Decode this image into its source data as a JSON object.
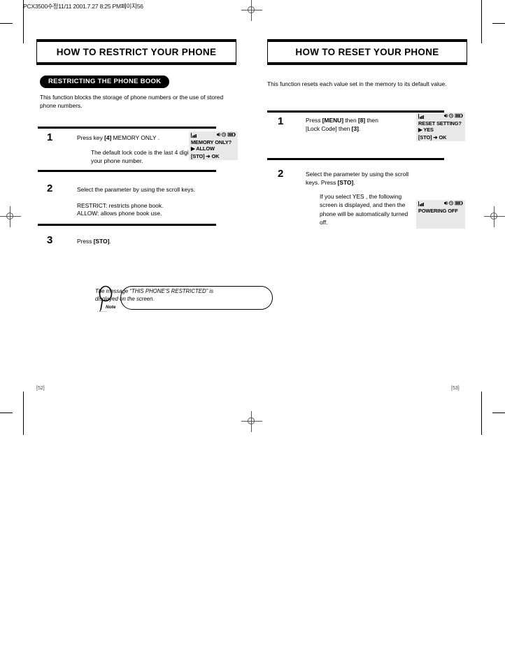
{
  "prepress": {
    "header": "PCX3500수정11/11  2001.7.27 8:25 PM페이지56"
  },
  "left_page": {
    "title": "HOW TO RESTRICT YOUR PHONE",
    "section_label": "RESTRICTING THE PHONE BOOK",
    "intro": "This function blocks the storage of phone numbers or the use of stored phone numbers.",
    "folio": "[52]",
    "steps": [
      {
        "number": "1",
        "text_plain": "Press key [4]  MEMORY ONLY .",
        "text_pre": "Press key ",
        "text_key": "[4]",
        "text_post": "  MEMORY ONLY .",
        "sub": "The default lock code is the last 4 digits of your phone number.",
        "lcd": {
          "signal": "signal-bars-icon",
          "icons": "speaker-alarm-battery-icons",
          "line1": "MEMORY ONLY?",
          "line2": "▶ ALLOW",
          "line3": "[STO] ➔ OK"
        }
      },
      {
        "number": "2",
        "text_plain": "Select the parameter by using the scroll keys.",
        "sub_a": "RESTRICT:  restricts phone book.",
        "sub_b": "ALLOW:  allows phone book use."
      },
      {
        "number": "3",
        "text_pre": "Press ",
        "text_key": "[STO]",
        "text_post": "."
      }
    ],
    "note": {
      "icon_label": "Note",
      "text": "The message “THIS PHONE’S RESTRICTED” is displayed on the screen."
    }
  },
  "right_page": {
    "title": "HOW TO RESET YOUR PHONE",
    "intro": "This function resets each value set in the memory to its default value.",
    "folio": "[53]",
    "steps": [
      {
        "number": "1",
        "line1_pre": "Press ",
        "line1_k1": "[MENU]",
        "line1_mid": " then ",
        "line1_k2": "[8]",
        "line1_post": " then",
        "line2_pre": "[Lock Code] then ",
        "line2_k1": "[3]",
        "line2_post": ".",
        "lcd": {
          "signal": "signal-bars-icon",
          "icons": "speaker-alarm-battery-icons",
          "line1": "RESET SETTING?",
          "line2": "▶ YES",
          "line3": "[STO] ➔ OK"
        }
      },
      {
        "number": "2",
        "line1": "Select the parameter by using the scroll",
        "line2_pre": "keys.  Press ",
        "line2_k1": "[STO]",
        "line2_post": ".",
        "sub": "If you select  YES , the following screen is displayed, and then the phone will be automatically turned off.",
        "lcd": {
          "signal": "signal-bars-icon",
          "icons": "speaker-alarm-battery-icons",
          "line1": "POWERING OFF",
          "line2": "",
          "line3": ""
        }
      }
    ]
  }
}
